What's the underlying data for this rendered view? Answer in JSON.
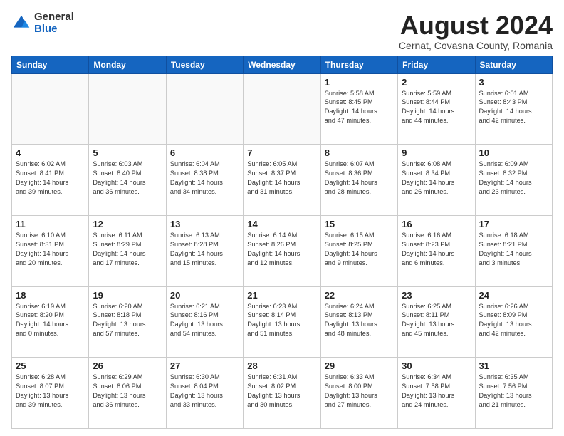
{
  "logo": {
    "general": "General",
    "blue": "Blue"
  },
  "title": "August 2024",
  "location": "Cernat, Covasna County, Romania",
  "weekdays": [
    "Sunday",
    "Monday",
    "Tuesday",
    "Wednesday",
    "Thursday",
    "Friday",
    "Saturday"
  ],
  "weeks": [
    [
      {
        "day": "",
        "info": ""
      },
      {
        "day": "",
        "info": ""
      },
      {
        "day": "",
        "info": ""
      },
      {
        "day": "",
        "info": ""
      },
      {
        "day": "1",
        "info": "Sunrise: 5:58 AM\nSunset: 8:45 PM\nDaylight: 14 hours\nand 47 minutes."
      },
      {
        "day": "2",
        "info": "Sunrise: 5:59 AM\nSunset: 8:44 PM\nDaylight: 14 hours\nand 44 minutes."
      },
      {
        "day": "3",
        "info": "Sunrise: 6:01 AM\nSunset: 8:43 PM\nDaylight: 14 hours\nand 42 minutes."
      }
    ],
    [
      {
        "day": "4",
        "info": "Sunrise: 6:02 AM\nSunset: 8:41 PM\nDaylight: 14 hours\nand 39 minutes."
      },
      {
        "day": "5",
        "info": "Sunrise: 6:03 AM\nSunset: 8:40 PM\nDaylight: 14 hours\nand 36 minutes."
      },
      {
        "day": "6",
        "info": "Sunrise: 6:04 AM\nSunset: 8:38 PM\nDaylight: 14 hours\nand 34 minutes."
      },
      {
        "day": "7",
        "info": "Sunrise: 6:05 AM\nSunset: 8:37 PM\nDaylight: 14 hours\nand 31 minutes."
      },
      {
        "day": "8",
        "info": "Sunrise: 6:07 AM\nSunset: 8:36 PM\nDaylight: 14 hours\nand 28 minutes."
      },
      {
        "day": "9",
        "info": "Sunrise: 6:08 AM\nSunset: 8:34 PM\nDaylight: 14 hours\nand 26 minutes."
      },
      {
        "day": "10",
        "info": "Sunrise: 6:09 AM\nSunset: 8:32 PM\nDaylight: 14 hours\nand 23 minutes."
      }
    ],
    [
      {
        "day": "11",
        "info": "Sunrise: 6:10 AM\nSunset: 8:31 PM\nDaylight: 14 hours\nand 20 minutes."
      },
      {
        "day": "12",
        "info": "Sunrise: 6:11 AM\nSunset: 8:29 PM\nDaylight: 14 hours\nand 17 minutes."
      },
      {
        "day": "13",
        "info": "Sunrise: 6:13 AM\nSunset: 8:28 PM\nDaylight: 14 hours\nand 15 minutes."
      },
      {
        "day": "14",
        "info": "Sunrise: 6:14 AM\nSunset: 8:26 PM\nDaylight: 14 hours\nand 12 minutes."
      },
      {
        "day": "15",
        "info": "Sunrise: 6:15 AM\nSunset: 8:25 PM\nDaylight: 14 hours\nand 9 minutes."
      },
      {
        "day": "16",
        "info": "Sunrise: 6:16 AM\nSunset: 8:23 PM\nDaylight: 14 hours\nand 6 minutes."
      },
      {
        "day": "17",
        "info": "Sunrise: 6:18 AM\nSunset: 8:21 PM\nDaylight: 14 hours\nand 3 minutes."
      }
    ],
    [
      {
        "day": "18",
        "info": "Sunrise: 6:19 AM\nSunset: 8:20 PM\nDaylight: 14 hours\nand 0 minutes."
      },
      {
        "day": "19",
        "info": "Sunrise: 6:20 AM\nSunset: 8:18 PM\nDaylight: 13 hours\nand 57 minutes."
      },
      {
        "day": "20",
        "info": "Sunrise: 6:21 AM\nSunset: 8:16 PM\nDaylight: 13 hours\nand 54 minutes."
      },
      {
        "day": "21",
        "info": "Sunrise: 6:23 AM\nSunset: 8:14 PM\nDaylight: 13 hours\nand 51 minutes."
      },
      {
        "day": "22",
        "info": "Sunrise: 6:24 AM\nSunset: 8:13 PM\nDaylight: 13 hours\nand 48 minutes."
      },
      {
        "day": "23",
        "info": "Sunrise: 6:25 AM\nSunset: 8:11 PM\nDaylight: 13 hours\nand 45 minutes."
      },
      {
        "day": "24",
        "info": "Sunrise: 6:26 AM\nSunset: 8:09 PM\nDaylight: 13 hours\nand 42 minutes."
      }
    ],
    [
      {
        "day": "25",
        "info": "Sunrise: 6:28 AM\nSunset: 8:07 PM\nDaylight: 13 hours\nand 39 minutes."
      },
      {
        "day": "26",
        "info": "Sunrise: 6:29 AM\nSunset: 8:06 PM\nDaylight: 13 hours\nand 36 minutes."
      },
      {
        "day": "27",
        "info": "Sunrise: 6:30 AM\nSunset: 8:04 PM\nDaylight: 13 hours\nand 33 minutes."
      },
      {
        "day": "28",
        "info": "Sunrise: 6:31 AM\nSunset: 8:02 PM\nDaylight: 13 hours\nand 30 minutes."
      },
      {
        "day": "29",
        "info": "Sunrise: 6:33 AM\nSunset: 8:00 PM\nDaylight: 13 hours\nand 27 minutes."
      },
      {
        "day": "30",
        "info": "Sunrise: 6:34 AM\nSunset: 7:58 PM\nDaylight: 13 hours\nand 24 minutes."
      },
      {
        "day": "31",
        "info": "Sunrise: 6:35 AM\nSunset: 7:56 PM\nDaylight: 13 hours\nand 21 minutes."
      }
    ]
  ]
}
